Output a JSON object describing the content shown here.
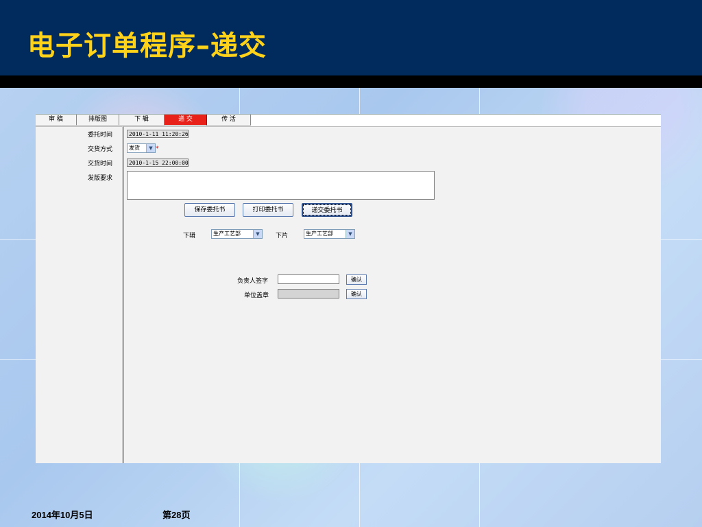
{
  "slide": {
    "title": "电子订单程序–递交",
    "date": "2014年10月5日",
    "page": "第28页"
  },
  "tabs": [
    {
      "label": "审 稿",
      "active": false
    },
    {
      "label": "排版图",
      "active": false
    },
    {
      "label": "下 辑",
      "active": false
    },
    {
      "label": "递 交",
      "active": true
    },
    {
      "label": "传 活",
      "active": false
    }
  ],
  "form": {
    "entrust_time_label": "委托时间",
    "entrust_time_value": "2010-1-11 11:20:26",
    "delivery_method_label": "交货方式",
    "delivery_method_value": "发货",
    "required_mark": "*",
    "delivery_time_label": "交货时间",
    "delivery_time_value": "2010-1-15 22:00:00",
    "requirements_label": "发版要求",
    "requirements_value": ""
  },
  "buttons": {
    "save": "保存委托书",
    "print": "打印委托书",
    "submit": "递交委托书"
  },
  "routing": {
    "xiaji_label": "下辑",
    "xiaji_value": "生产工艺部",
    "xiapian_label": "下片",
    "xiapian_value": "生产工艺部"
  },
  "signature": {
    "signer_label": "负责人签字",
    "signer_value": "",
    "confirm1": "确认",
    "seal_label": "单位盖章",
    "seal_value": "",
    "confirm2": "确认"
  }
}
